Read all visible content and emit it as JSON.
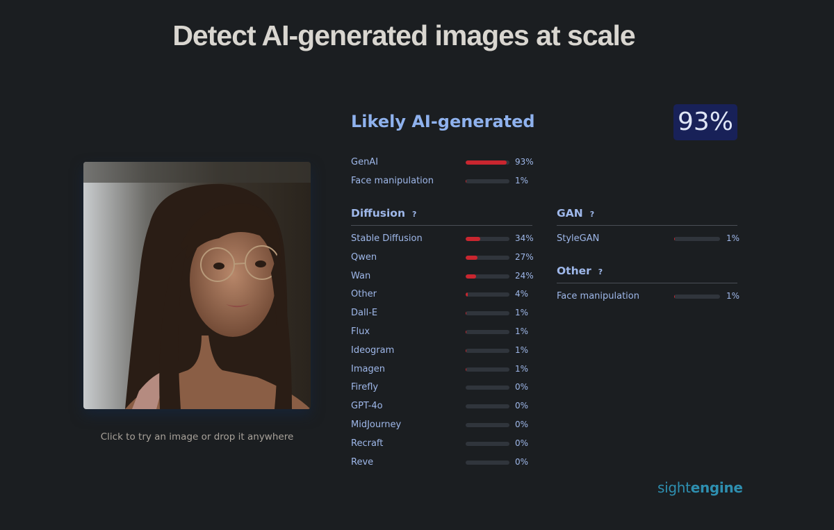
{
  "headline": "Detect AI-generated images at scale",
  "drop_hint": "Click to try an image or drop it anywhere",
  "result": {
    "verdict": "Likely AI-generated",
    "score": "93%",
    "summary": [
      {
        "label": "GenAI",
        "value": 93,
        "text": "93%"
      },
      {
        "label": "Face manipulation",
        "value": 1,
        "text": "1%"
      }
    ]
  },
  "diffusion": {
    "title": "Diffusion",
    "help": "?",
    "items": [
      {
        "label": "Stable Diffusion",
        "value": 34,
        "text": "34%"
      },
      {
        "label": "Qwen",
        "value": 27,
        "text": "27%"
      },
      {
        "label": "Wan",
        "value": 24,
        "text": "24%"
      },
      {
        "label": "Other",
        "value": 4,
        "text": "4%"
      },
      {
        "label": "Dall-E",
        "value": 1,
        "text": "1%"
      },
      {
        "label": "Flux",
        "value": 1,
        "text": "1%"
      },
      {
        "label": "Ideogram",
        "value": 1,
        "text": "1%"
      },
      {
        "label": "Imagen",
        "value": 1,
        "text": "1%"
      },
      {
        "label": "Firefly",
        "value": 0,
        "text": "0%"
      },
      {
        "label": "GPT-4o",
        "value": 0,
        "text": "0%"
      },
      {
        "label": "MidJourney",
        "value": 0,
        "text": "0%"
      },
      {
        "label": "Recraft",
        "value": 0,
        "text": "0%"
      },
      {
        "label": "Reve",
        "value": 0,
        "text": "0%"
      }
    ]
  },
  "gan": {
    "title": "GAN",
    "help": "?",
    "items": [
      {
        "label": "StyleGAN",
        "value": 1,
        "text": "1%"
      }
    ]
  },
  "other": {
    "title": "Other",
    "help": "?",
    "items": [
      {
        "label": "Face manipulation",
        "value": 1,
        "text": "1%"
      }
    ]
  },
  "brand": {
    "light": "sight",
    "bold": "engine"
  },
  "colors": {
    "background": "#1b1e21",
    "accent": "#9fb8ea",
    "bar_fill": "#c9262f",
    "badge": "#182158"
  }
}
